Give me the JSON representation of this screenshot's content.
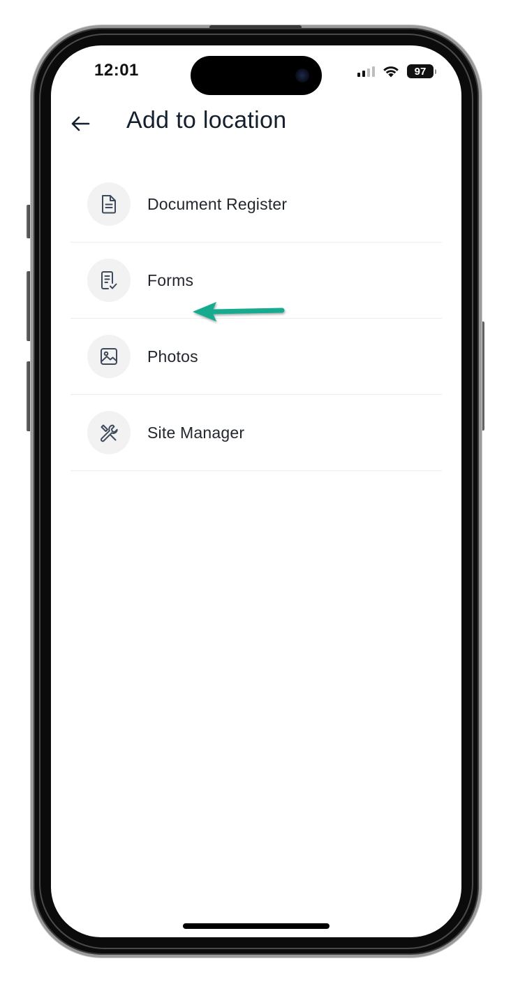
{
  "status_bar": {
    "time": "12:01",
    "battery": "97",
    "icons": [
      "cellular-signal-icon",
      "wifi-icon",
      "battery-icon"
    ]
  },
  "header": {
    "back_icon": "arrow-left-icon",
    "title": "Add to location"
  },
  "menu": {
    "items": [
      {
        "label": "Document Register",
        "icon": "document-icon"
      },
      {
        "label": "Forms",
        "icon": "form-checklist-icon"
      },
      {
        "label": "Photos",
        "icon": "image-icon"
      },
      {
        "label": "Site Manager",
        "icon": "tools-icon"
      }
    ]
  },
  "annotation": {
    "type": "arrow",
    "points_to": "Photos",
    "color": "#19ab8f"
  },
  "colors": {
    "title": "#15202e",
    "icon_stroke": "#3e4a5c",
    "icon_background": "#f2f2f3",
    "divider": "#ececec",
    "annotation_arrow": "#19ab8f"
  }
}
